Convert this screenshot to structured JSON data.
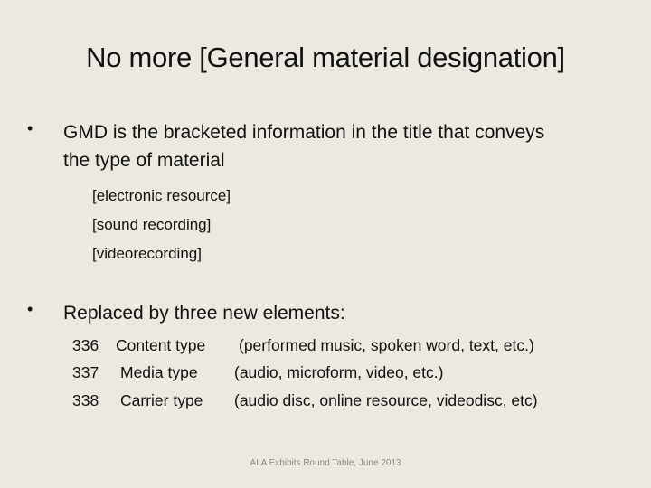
{
  "slide": {
    "title": "No more [General material designation]",
    "bullets": [
      {
        "text_line1": "GMD is the bracketed information in the title that conveys",
        "text_line2": "the type of material",
        "sub_items": [
          "[electronic resource]",
          "[sound recording]",
          "[videorecording]"
        ]
      },
      {
        "text": "Replaced by three new elements:",
        "elements": [
          {
            "field": "336",
            "label": "Content type",
            "description": "(performed music, spoken word, text, etc.)"
          },
          {
            "field": "337",
            "label": "Media type",
            "description": "(audio, microform, video, etc.)"
          },
          {
            "field": "338",
            "label": "Carrier type",
            "description": "(audio disc, online resource, videodisc, etc)"
          }
        ]
      }
    ],
    "footer": "ALA Exhibits Round Table, June 2013",
    "bullet_glyph": "•",
    "background_color": "#ECE9E0"
  }
}
